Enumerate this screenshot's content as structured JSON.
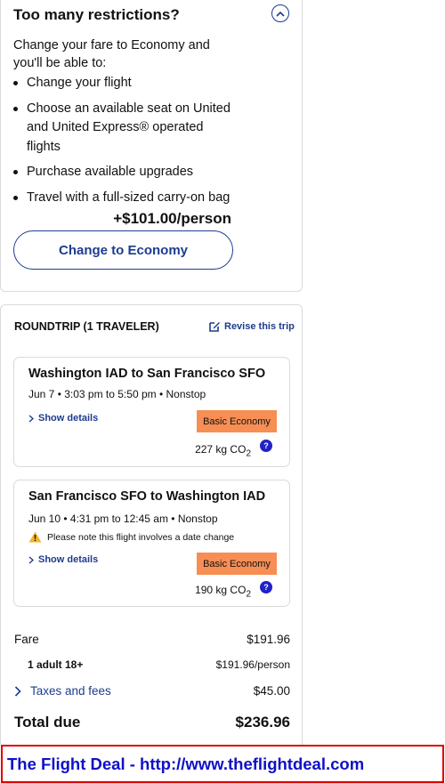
{
  "upsell": {
    "title": "Too many restrictions?",
    "intro": "Change your fare to Economy and you'll be able to:",
    "benefits": [
      "Change your flight",
      "Choose an available seat on United and United Express® operated flights",
      "Purchase available upgrades",
      "Travel with a full-sized carry-on bag"
    ],
    "price": "+$101.00/person",
    "button_label": "Change to Economy",
    "collapse_icon": "chevron-up-icon"
  },
  "trip": {
    "type_label": "ROUNDTRIP (1 TRAVELER)",
    "revise_label": "Revise this trip",
    "revise_icon": "edit-icon",
    "segments": [
      {
        "route": "Washington IAD to San Francisco SFO",
        "times": "Jun 7 • 3:03 pm to 5:50 pm • Nonstop",
        "warning": "",
        "details_label": "Show details",
        "fare_class": "Basic Economy",
        "co2_value": "227 kg CO",
        "co2_sub": "2"
      },
      {
        "route": "San Francisco SFO to Washington IAD",
        "times": "Jun 10 • 4:31 pm to 12:45 am • Nonstop",
        "warning": "Please note this flight involves a date change",
        "details_label": "Show details",
        "fare_class": "Basic Economy",
        "co2_value": "190 kg CO",
        "co2_sub": "2"
      }
    ]
  },
  "price_summary": {
    "fare_label": "Fare",
    "fare_amount": "$191.96",
    "adult_label": "1 adult 18+",
    "adult_amount": "$191.96/person",
    "taxes_label": "Taxes and fees",
    "taxes_amount": "$45.00",
    "total_label": "Total due",
    "total_amount": "$236.96"
  },
  "banner": {
    "text": "The Flight Deal - http://www.theflightdeal.com"
  },
  "colors": {
    "link": "#1d3c8f",
    "fare_badge": "#f78e54",
    "help_icon": "#2121c9",
    "banner_border": "#e00000",
    "banner_text": "#1010c8"
  }
}
